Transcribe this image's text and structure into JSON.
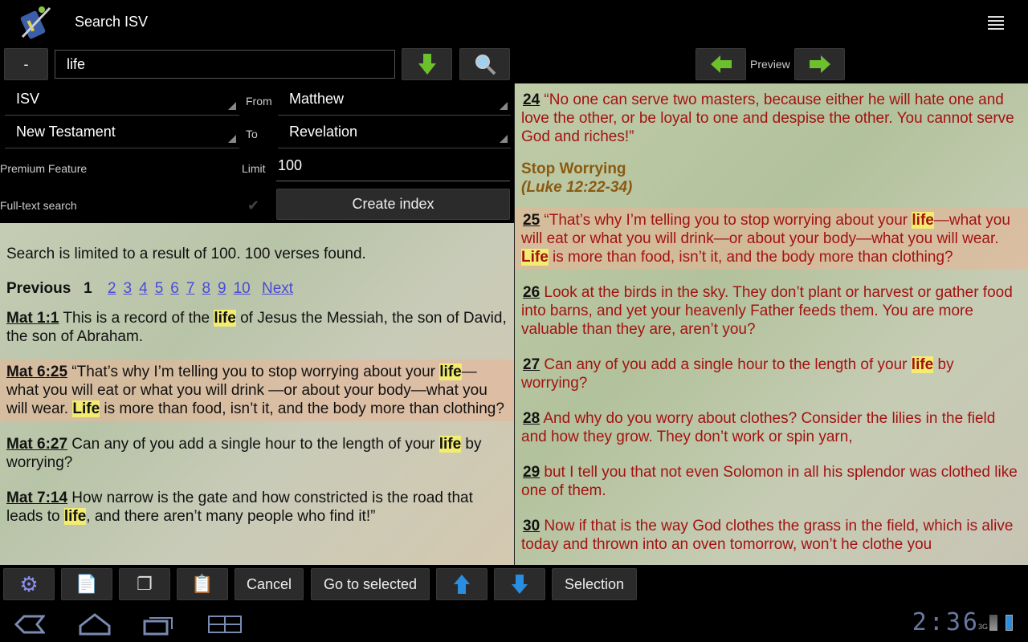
{
  "header": {
    "title": "Search ISV",
    "logo": "sword-phone-logo",
    "menu_icon": "overflow-menu-icon"
  },
  "search": {
    "minus_label": "-",
    "query": "life",
    "down_icon": "green-down-arrow-icon",
    "search_icon": "magnifier-icon"
  },
  "form": {
    "translation": "ISV",
    "from_label": "From",
    "from_value": "Matthew",
    "scope": "New Testament",
    "to_label": "To",
    "to_value": "Revelation",
    "premium_label": "Premium Feature",
    "limit_label": "Limit",
    "limit_value": "100",
    "fulltext_label": "Full-text search",
    "fulltext_checked": true,
    "create_index_label": "Create index"
  },
  "results": {
    "summary": "Search is limited to a result of 100. 100 verses found.",
    "previous": "Previous",
    "current_page": "1",
    "pages": [
      "2",
      "3",
      "4",
      "5",
      "6",
      "7",
      "8",
      "9",
      "10"
    ],
    "next": "Next",
    "items": [
      {
        "ref": "Mat 1:1",
        "selected": false,
        "segments": [
          {
            "t": " This is a record of the "
          },
          {
            "t": "life",
            "hl": true
          },
          {
            "t": " of Jesus the Messiah, the son of David, the son of Abraham."
          }
        ]
      },
      {
        "ref": "Mat 6:25",
        "selected": true,
        "segments": [
          {
            "t": " “That’s why I’m telling you to stop worrying about your "
          },
          {
            "t": "life",
            "hl": true
          },
          {
            "t": "—what you will eat or what you will drink —or about your body—what you will wear. "
          },
          {
            "t": "Life",
            "hl": true
          },
          {
            "t": " is more than food, isn’t it, and the body more than clothing?"
          }
        ]
      },
      {
        "ref": "Mat 6:27",
        "selected": false,
        "segments": [
          {
            "t": " Can any of you add a single hour to the length of your "
          },
          {
            "t": "life",
            "hl": true
          },
          {
            "t": " by worrying?"
          }
        ]
      },
      {
        "ref": "Mat 7:14",
        "selected": false,
        "segments": [
          {
            "t": " How narrow is the gate and how constricted is the road that leads to "
          },
          {
            "t": "life",
            "hl": true
          },
          {
            "t": ", and there aren’t many people who find it!”"
          }
        ]
      }
    ]
  },
  "preview": {
    "label": "Preview",
    "prev_icon": "green-left-arrow-icon",
    "next_icon": "green-right-arrow-icon",
    "heading": "Stop Worrying",
    "heading_ref": "(Luke 12:22-34)",
    "verses": [
      {
        "num": "24",
        "selected": false,
        "segments": [
          {
            "t": " “No one can serve two masters, because either he will hate one and love the other, or be loyal to one and despise the other. You cannot serve God and riches!”"
          }
        ]
      },
      {
        "num": "25",
        "selected": true,
        "segments": [
          {
            "t": " “That’s why I’m telling you to stop worrying about your "
          },
          {
            "t": "life",
            "hl": true
          },
          {
            "t": "—what you will eat or what you will drink—or about your body—what you will wear. "
          },
          {
            "t": "Life",
            "hl": true
          },
          {
            "t": " is more than food, isn’t it, and the body more than clothing?"
          }
        ]
      },
      {
        "num": "26",
        "selected": false,
        "segments": [
          {
            "t": " Look at the birds in the sky. They don’t plant or harvest or gather food into barns, and yet your heavenly Father feeds them. You are more valuable than they are, aren’t you?"
          }
        ]
      },
      {
        "num": "27",
        "selected": false,
        "segments": [
          {
            "t": " Can any of you add a single hour to the length of your "
          },
          {
            "t": "life",
            "hl": true
          },
          {
            "t": " by worrying?"
          }
        ]
      },
      {
        "num": "28",
        "selected": false,
        "segments": [
          {
            "t": " And why do you worry about clothes? Consider the lilies in the field and how they grow. They don’t work or spin yarn,"
          }
        ]
      },
      {
        "num": "29",
        "selected": false,
        "segments": [
          {
            "t": " but I tell you that not even Solomon in all his splendor was clothed like one of them."
          }
        ]
      },
      {
        "num": "30",
        "selected": false,
        "segments": [
          {
            "t": " Now if that is the way God clothes the grass in the field, which is alive today and thrown into an oven tomorrow, won’t he clothe you"
          }
        ]
      }
    ]
  },
  "toolbar": {
    "settings_icon": "gear-icon",
    "copy_add_icon": "copy-add-icon",
    "copy_icon": "copy-pages-icon",
    "clipboard_icon": "clipboard-search-icon",
    "cancel": "Cancel",
    "go_to_selected": "Go to selected",
    "up_icon": "blue-up-arrow-icon",
    "down_icon": "blue-down-arrow-icon",
    "selection": "Selection"
  },
  "system": {
    "time": "2:36",
    "network": "3G"
  },
  "colors": {
    "preview_text": "#a31212",
    "highlight": "#f2ec70",
    "link": "#4a4ad8",
    "selected_bg": "#ebb496"
  }
}
